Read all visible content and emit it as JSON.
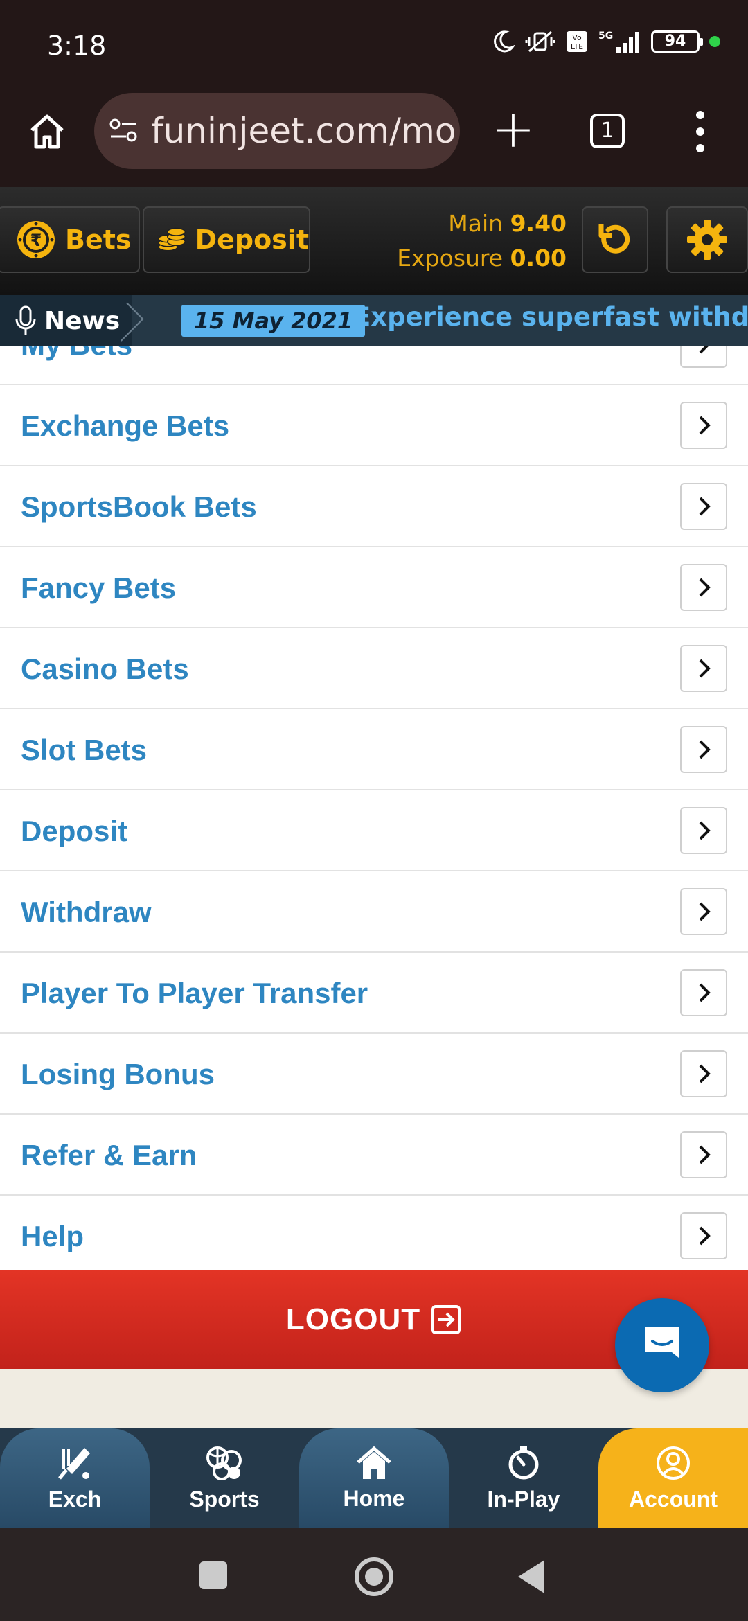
{
  "status_bar": {
    "time": "3:18",
    "battery": "94"
  },
  "browser": {
    "url": "funinjeet.com/mo",
    "tab_count": "1"
  },
  "header": {
    "bets_label": "Bets",
    "deposit_label": "Deposit",
    "main_label": "Main",
    "main_value": "9.40",
    "exposure_label": "Exposure",
    "exposure_value": "0.00"
  },
  "news": {
    "label": "News",
    "date": "15 May 2021",
    "text": "Experience superfast withdrawal"
  },
  "menu": {
    "partial_label": "My Bets",
    "items": [
      {
        "label": "Exchange Bets"
      },
      {
        "label": "SportsBook Bets"
      },
      {
        "label": "Fancy Bets"
      },
      {
        "label": "Casino Bets"
      },
      {
        "label": "Slot Bets"
      },
      {
        "label": "Deposit"
      },
      {
        "label": "Withdraw"
      },
      {
        "label": "Player To Player Transfer"
      },
      {
        "label": "Losing Bonus"
      },
      {
        "label": "Refer & Earn"
      },
      {
        "label": "Help"
      }
    ]
  },
  "logout_label": "LOGOUT",
  "bottom_nav": {
    "exch": "Exch",
    "sports": "Sports",
    "home": "Home",
    "inplay": "In-Play",
    "account": "Account"
  },
  "colors": {
    "accent_gold": "#f5b40e",
    "link_blue": "#2e86c1",
    "logout_red": "#d42b20",
    "nav_dark": "#25394a"
  }
}
